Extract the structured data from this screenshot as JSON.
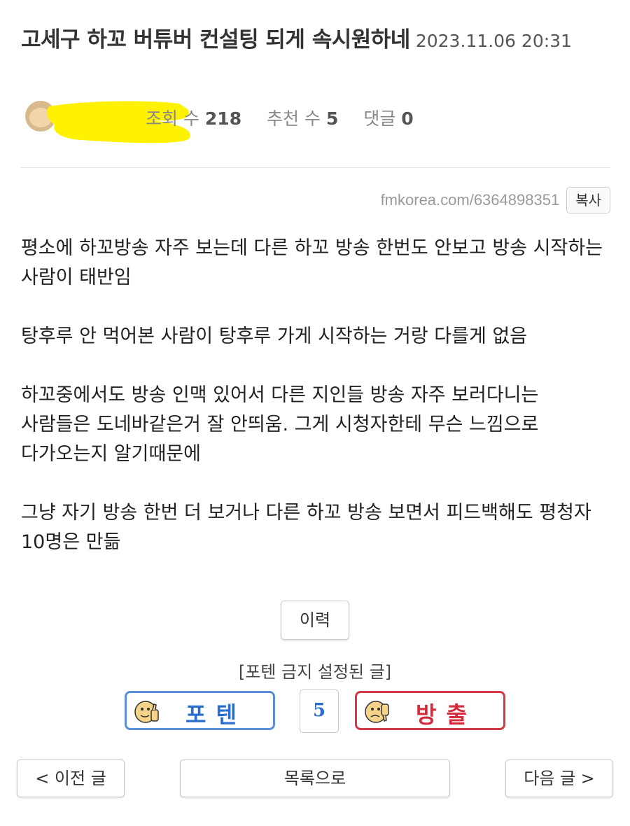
{
  "post": {
    "title": "고세구 하꼬 버튜버 컨설팅 되게 속시원하네",
    "date": "2023.11.06 20:31",
    "views_label": "조회 수",
    "views": "218",
    "recommend_label": "추천 수",
    "recommend": "5",
    "comments_label": "댓글",
    "comments": "0",
    "url": "fmkorea.com/6364898351",
    "copy_label": "복사",
    "paragraphs": [
      "평소에 하꼬방송 자주 보는데 다른 하꼬 방송 한번도 안보고 방송 시작하는 사람이 태반임",
      "탕후루 안 먹어본 사람이 탕후루 가게 시작하는 거랑 다를게 없음",
      "하꼬중에서도 방송 인맥 있어서 다른 지인들 방송 자주 보러다니는 사람들은 도네바같은거 잘 안띄움. 그게 시청자한테 무슨 느낌으로 다가오는지 알기때문에",
      "그냥 자기 방송 한번 더 보거나 다른 하꼬 방송 보면서 피드백해도 평청자 10명은 만듦"
    ]
  },
  "actions": {
    "history_label": "이력",
    "fortune_note": "[포텐 금지 설정된 글]",
    "upvote_label": "포텐",
    "downvote_label": "방출",
    "vote_count": "5"
  },
  "nav": {
    "prev_label": "< 이전 글",
    "list_label": "목록으로",
    "next_label": "다음 글 >"
  },
  "colors": {
    "upvote": "#2a6fcf",
    "downvote": "#d42a3a",
    "censor": "#fff200"
  }
}
